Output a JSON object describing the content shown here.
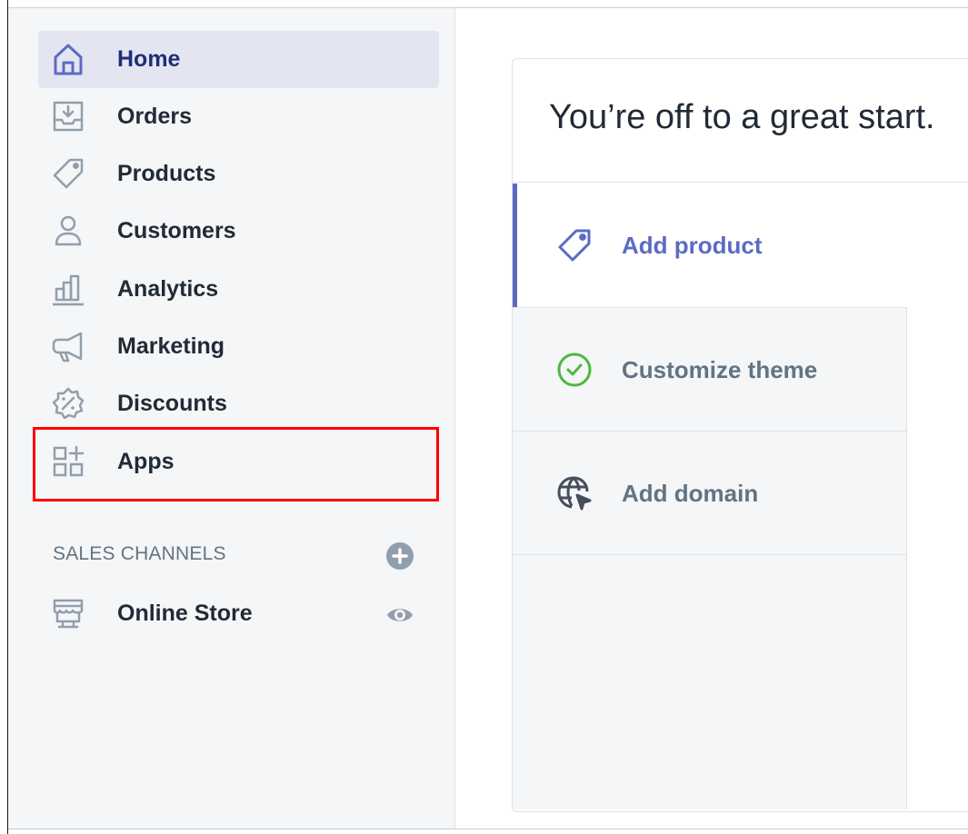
{
  "sidebar": {
    "items": [
      {
        "label": "Home",
        "icon": "home-icon",
        "active": true
      },
      {
        "label": "Orders",
        "icon": "orders-icon"
      },
      {
        "label": "Products",
        "icon": "tag-icon"
      },
      {
        "label": "Customers",
        "icon": "person-icon"
      },
      {
        "label": "Analytics",
        "icon": "bar-chart-icon"
      },
      {
        "label": "Marketing",
        "icon": "megaphone-icon"
      },
      {
        "label": "Discounts",
        "icon": "discount-icon"
      },
      {
        "label": "Apps",
        "icon": "apps-icon"
      }
    ],
    "sales_channels": {
      "title": "SALES CHANNELS",
      "add_icon": "plus-circle-icon",
      "items": [
        {
          "label": "Online Store",
          "icon": "store-icon",
          "action_icon": "eye-icon"
        }
      ]
    }
  },
  "main": {
    "card_title": "You’re off to a great start.",
    "tasks": [
      {
        "label": "Add product",
        "icon": "tag-icon",
        "active": true
      },
      {
        "label": "Customize theme",
        "icon": "check-circle-icon"
      },
      {
        "label": "Add domain",
        "icon": "globe-cursor-icon"
      }
    ]
  },
  "colors": {
    "accent": "#5c6ac4",
    "active_nav_bg": "#e3e6f1",
    "sidebar_bg": "#f4f6f8",
    "check_green": "#50b83c",
    "highlight": "#ff0000"
  }
}
